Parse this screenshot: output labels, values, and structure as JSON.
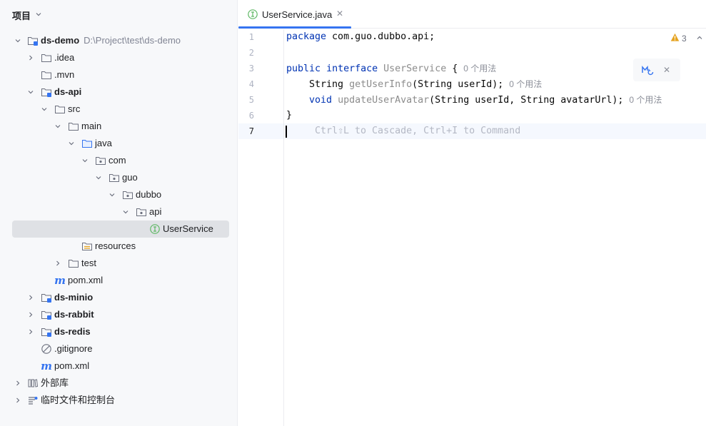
{
  "project_panel": {
    "title": "项目",
    "items": [
      {
        "label": "ds-demo",
        "path": "D:\\Project\\test\\ds-demo"
      },
      {
        "label": ".idea"
      },
      {
        "label": ".mvn"
      },
      {
        "label": "ds-api"
      },
      {
        "label": "src"
      },
      {
        "label": "main"
      },
      {
        "label": "java"
      },
      {
        "label": "com"
      },
      {
        "label": "guo"
      },
      {
        "label": "dubbo"
      },
      {
        "label": "api"
      },
      {
        "label": "UserService"
      },
      {
        "label": "resources"
      },
      {
        "label": "test"
      },
      {
        "label": "pom.xml"
      },
      {
        "label": "ds-minio"
      },
      {
        "label": "ds-rabbit"
      },
      {
        "label": "ds-redis"
      },
      {
        "label": ".gitignore"
      },
      {
        "label": "pom.xml"
      },
      {
        "label": "外部库"
      },
      {
        "label": "临时文件和控制台"
      }
    ]
  },
  "editor": {
    "tab": {
      "label": "UserService.java"
    },
    "line_numbers": [
      "1",
      "2",
      "3",
      "4",
      "5",
      "6",
      "7"
    ],
    "code": {
      "l1_kw": "package",
      "l1_rest": " com.guo.dubbo.api;",
      "l3_kw1": "public",
      "l3_kw2": "interface",
      "l3_name": "UserService",
      "l3_brace": " {",
      "l3_hint": "0 个用法",
      "l4_type": "String",
      "l4_method": "getUserInfo",
      "l4_params": "(String userId);",
      "l4_hint": "0 个用法",
      "l5_kw": "void",
      "l5_method": "updateUserAvatar",
      "l5_params": "(String userId, String avatarUrl);",
      "l5_hint": "0 个用法",
      "l6": "}",
      "l7_ghost": "Ctrl⇧L to Cascade, Ctrl+I to Command"
    },
    "warnings_count": "3",
    "colors": {
      "keyword": "#0033b3",
      "declaration": "#00627a",
      "accent": "#3574f0",
      "selection": "#dfe1e5",
      "warning": "#e5a21d",
      "interface_icon": "#5fb865"
    }
  }
}
